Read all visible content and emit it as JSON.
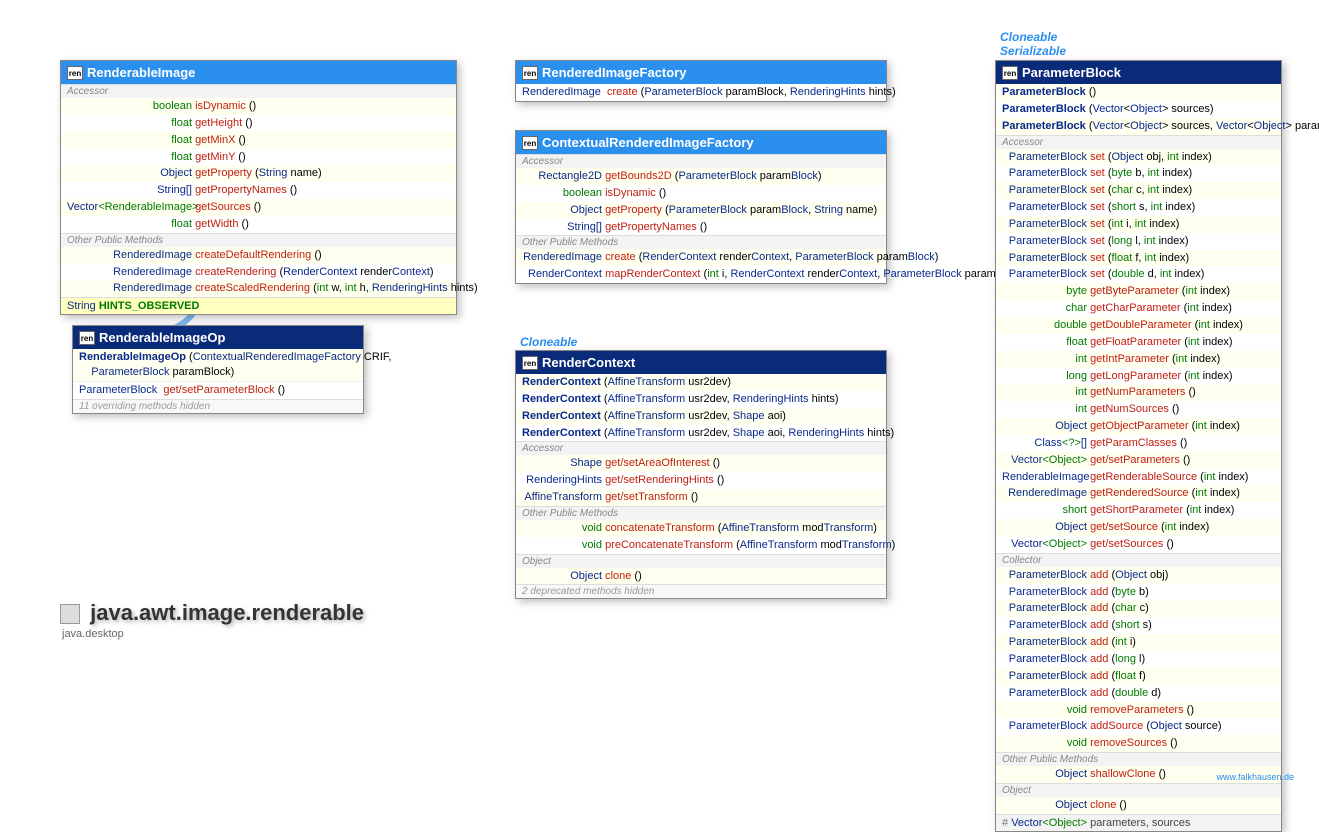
{
  "package": {
    "name": "java.awt.image.renderable",
    "module": "java.desktop"
  },
  "watermark": "www.falkhausen.de",
  "labels": {
    "accessor": "Accessor",
    "otherPublic": "Other Public Methods",
    "collector": "Collector",
    "object": "Object",
    "cloneable": "Cloneable",
    "serializable": "Serializable"
  },
  "renderableImage": {
    "title": "RenderableImage",
    "acc": [
      {
        "ret": "boolean",
        "name": "isDynamic",
        "args": "()"
      },
      {
        "ret": "float",
        "name": "getHeight",
        "args": "()"
      },
      {
        "ret": "float",
        "name": "getMinX",
        "args": "()"
      },
      {
        "ret": "float",
        "name": "getMinY",
        "args": "()"
      },
      {
        "ret": "Object",
        "name": "getProperty",
        "args": "(String name)"
      },
      {
        "ret": "String[]",
        "name": "getPropertyNames",
        "args": "()"
      },
      {
        "ret": "Vector<RenderableImage>",
        "name": "getSources",
        "args": "()"
      },
      {
        "ret": "float",
        "name": "getWidth",
        "args": "()"
      }
    ],
    "other": [
      {
        "ret": "RenderedImage",
        "name": "createDefaultRendering",
        "args": "()"
      },
      {
        "ret": "RenderedImage",
        "name": "createRendering",
        "args": "(RenderContext renderContext)"
      },
      {
        "ret": "RenderedImage",
        "name": "createScaledRendering",
        "args": "(int w, int h, RenderingHints hints)"
      }
    ],
    "constant": {
      "type": "String",
      "name": "HINTS_OBSERVED"
    }
  },
  "renderableImageOp": {
    "title": "RenderableImageOp",
    "ctor": "RenderableImageOp (ContextualRenderedImageFactory CRIF, ParameterBlock paramBlock)",
    "row": {
      "ret": "ParameterBlock",
      "name": "get/setParameterBlock",
      "args": "()"
    },
    "hidden": "11 overriding methods hidden"
  },
  "renderedImageFactory": {
    "title": "RenderedImageFactory",
    "row": {
      "ret": "RenderedImage",
      "name": "create",
      "args": "(ParameterBlock paramBlock, RenderingHints hints)"
    }
  },
  "contextualRIF": {
    "title": "ContextualRenderedImageFactory",
    "acc": [
      {
        "ret": "Rectangle2D",
        "name": "getBounds2D",
        "args": "(ParameterBlock paramBlock)"
      },
      {
        "ret": "boolean",
        "name": "isDynamic",
        "args": "()"
      },
      {
        "ret": "Object",
        "name": "getProperty",
        "args": "(ParameterBlock paramBlock, String name)"
      },
      {
        "ret": "String[]",
        "name": "getPropertyNames",
        "args": "()"
      }
    ],
    "other": [
      {
        "ret": "RenderedImage",
        "name": "create",
        "args": "(RenderContext renderContext, ParameterBlock paramBlock)"
      },
      {
        "ret": "RenderContext",
        "name": "mapRenderContext",
        "args": "(int i, RenderContext renderContext, ParameterBlock paramBlock, RenderableImage image)"
      }
    ]
  },
  "renderContext": {
    "title": "RenderContext",
    "ctors": [
      "RenderContext (AffineTransform usr2dev)",
      "RenderContext (AffineTransform usr2dev, RenderingHints hints)",
      "RenderContext (AffineTransform usr2dev, Shape aoi)",
      "RenderContext (AffineTransform usr2dev, Shape aoi, RenderingHints hints)"
    ],
    "acc": [
      {
        "ret": "Shape",
        "name": "get/setAreaOfInterest",
        "args": "()"
      },
      {
        "ret": "RenderingHints",
        "name": "get/setRenderingHints",
        "args": "()"
      },
      {
        "ret": "AffineTransform",
        "name": "get/setTransform",
        "args": "()"
      }
    ],
    "other": [
      {
        "ret": "void",
        "name": "concatenateTransform",
        "args": "(AffineTransform modTransform)"
      },
      {
        "ret": "void",
        "name": "preConcatenateTransform",
        "args": "(AffineTransform modTransform)"
      }
    ],
    "obj": [
      {
        "ret": "Object",
        "name": "clone",
        "args": "()"
      }
    ],
    "hidden": "2 deprecated methods hidden"
  },
  "parameterBlock": {
    "title": "ParameterBlock",
    "ctors": [
      "ParameterBlock ()",
      "ParameterBlock (Vector<Object> sources)",
      "ParameterBlock (Vector<Object> sources, Vector<Object> parameters)"
    ],
    "acc": [
      {
        "ret": "ParameterBlock",
        "name": "set",
        "args": "(Object obj, int index)"
      },
      {
        "ret": "ParameterBlock",
        "name": "set",
        "args": "(byte b, int index)"
      },
      {
        "ret": "ParameterBlock",
        "name": "set",
        "args": "(char c, int index)"
      },
      {
        "ret": "ParameterBlock",
        "name": "set",
        "args": "(short s, int index)"
      },
      {
        "ret": "ParameterBlock",
        "name": "set",
        "args": "(int i, int index)"
      },
      {
        "ret": "ParameterBlock",
        "name": "set",
        "args": "(long l, int index)"
      },
      {
        "ret": "ParameterBlock",
        "name": "set",
        "args": "(float f, int index)"
      },
      {
        "ret": "ParameterBlock",
        "name": "set",
        "args": "(double d, int index)"
      },
      {
        "ret": "byte",
        "name": "getByteParameter",
        "args": "(int index)"
      },
      {
        "ret": "char",
        "name": "getCharParameter",
        "args": "(int index)"
      },
      {
        "ret": "double",
        "name": "getDoubleParameter",
        "args": "(int index)"
      },
      {
        "ret": "float",
        "name": "getFloatParameter",
        "args": "(int index)"
      },
      {
        "ret": "int",
        "name": "getIntParameter",
        "args": "(int index)"
      },
      {
        "ret": "long",
        "name": "getLongParameter",
        "args": "(int index)"
      },
      {
        "ret": "int",
        "name": "getNumParameters",
        "args": "()"
      },
      {
        "ret": "int",
        "name": "getNumSources",
        "args": "()"
      },
      {
        "ret": "Object",
        "name": "getObjectParameter",
        "args": "(int index)"
      },
      {
        "ret": "Class<?>[]",
        "name": "getParamClasses",
        "args": "()"
      },
      {
        "ret": "Vector<Object>",
        "name": "get/setParameters",
        "args": "()"
      },
      {
        "ret": "RenderableImage",
        "name": "getRenderableSource",
        "args": "(int index)"
      },
      {
        "ret": "RenderedImage",
        "name": "getRenderedSource",
        "args": "(int index)"
      },
      {
        "ret": "short",
        "name": "getShortParameter",
        "args": "(int index)"
      },
      {
        "ret": "Object",
        "name": "get/setSource",
        "args": "(int index)"
      },
      {
        "ret": "Vector<Object>",
        "name": "get/setSources",
        "args": "()"
      }
    ],
    "coll": [
      {
        "ret": "ParameterBlock",
        "name": "add",
        "args": "(Object obj)"
      },
      {
        "ret": "ParameterBlock",
        "name": "add",
        "args": "(byte b)"
      },
      {
        "ret": "ParameterBlock",
        "name": "add",
        "args": "(char c)"
      },
      {
        "ret": "ParameterBlock",
        "name": "add",
        "args": "(short s)"
      },
      {
        "ret": "ParameterBlock",
        "name": "add",
        "args": "(int i)"
      },
      {
        "ret": "ParameterBlock",
        "name": "add",
        "args": "(long l)"
      },
      {
        "ret": "ParameterBlock",
        "name": "add",
        "args": "(float f)"
      },
      {
        "ret": "ParameterBlock",
        "name": "add",
        "args": "(double d)"
      },
      {
        "ret": "void",
        "name": "removeParameters",
        "args": "()"
      },
      {
        "ret": "ParameterBlock",
        "name": "addSource",
        "args": "(Object source)"
      },
      {
        "ret": "void",
        "name": "removeSources",
        "args": "()"
      }
    ],
    "other": [
      {
        "ret": "Object",
        "name": "shallowClone",
        "args": "()"
      }
    ],
    "obj": [
      {
        "ret": "Object",
        "name": "clone",
        "args": "()"
      }
    ],
    "fields": "# Vector<Object> parameters, sources"
  }
}
